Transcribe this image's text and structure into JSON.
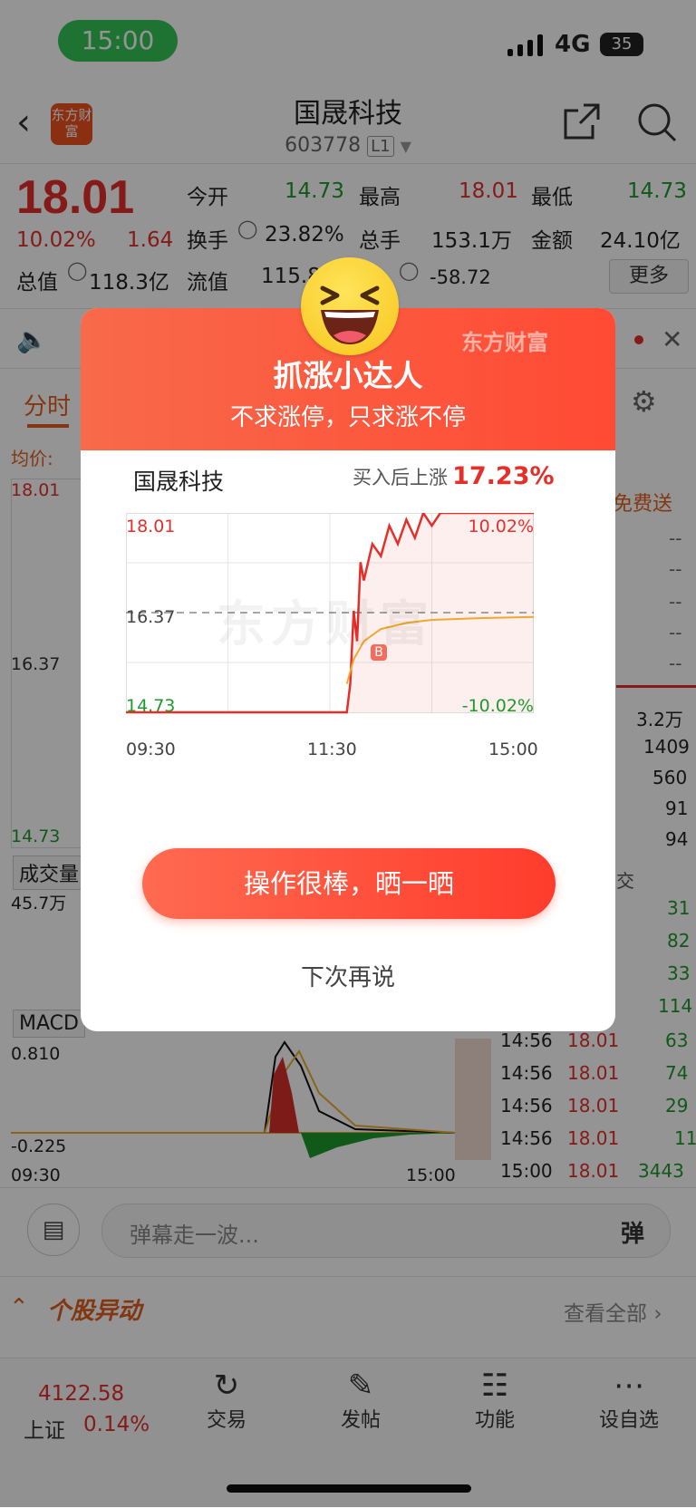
{
  "status_bar": {
    "time": "15:00",
    "network": "4G",
    "battery": "35"
  },
  "header": {
    "title": "国晟科技",
    "code": "603778",
    "level": "L1",
    "logo_text": "东方财富"
  },
  "quote": {
    "price": "18.01",
    "change_pct": "10.02%",
    "change": "1.64",
    "open_label": "今开",
    "open": "14.73",
    "high_label": "最高",
    "high": "18.01",
    "low_label": "最低",
    "low": "14.73",
    "turnover_label": "换手",
    "turnover": "23.82%",
    "volume_label": "总手",
    "volume": "153.1万",
    "amount_label": "金额",
    "amount": "24.10亿",
    "mktcap_label": "总值",
    "mktcap": "118.3亿",
    "float_label": "流值",
    "float": "115.8",
    "pe_label": "盈",
    "pe_sup": "动",
    "pe": "-58.72",
    "more": "更多"
  },
  "tabs": {
    "active": "分时",
    "avg_label": "均价:"
  },
  "chart_bg": {
    "p_high": "18.01",
    "p_mid": "16.37",
    "p_low": "14.73",
    "volume_tab": "成交量",
    "volume_val": "45.7万",
    "macd_tab": "MACD",
    "macd_high": "0.810",
    "macd_low": "-0.225",
    "t_start": "09:30",
    "t_end": "15:00"
  },
  "right_panel": {
    "promo": "免费送",
    "dashes": [
      "--",
      "--",
      "--",
      "--",
      "--"
    ],
    "vols": [
      "3.2万",
      "1409",
      "560",
      "91",
      "94"
    ],
    "trades_header": "交",
    "trade_vols_top": [
      "31",
      "82",
      "33",
      "114"
    ],
    "trades": [
      {
        "time": "14:56",
        "price": "18.01",
        "vol": "63"
      },
      {
        "time": "14:56",
        "price": "18.01",
        "vol": "74"
      },
      {
        "time": "14:56",
        "price": "18.01",
        "vol": "29"
      },
      {
        "time": "14:56",
        "price": "18.01",
        "vol": "11"
      },
      {
        "time": "15:00",
        "price": "18.01",
        "vol": "3443"
      }
    ]
  },
  "comment_bar": {
    "placeholder": "弹幕走一波...",
    "danmu": "弹"
  },
  "movement": {
    "title": "个股异动",
    "view_all": "查看全部"
  },
  "bottom_nav": {
    "index_value": "4122.58",
    "index_name": "上证",
    "index_change": "0.14%",
    "items": [
      "交易",
      "发帖",
      "功能",
      "设自选"
    ]
  },
  "modal": {
    "title": "抓涨小达人",
    "subtitle": "不求涨停，只求涨不停",
    "brand": "东方财富",
    "stock_name": "国晟科技",
    "gain_label": "买入后上涨",
    "gain_value": "17.23%",
    "cta": "操作很棒，晒一晒",
    "later": "下次再说",
    "chart_watermark": "东方财富",
    "buy_marker": "B"
  },
  "chart_data": {
    "type": "line",
    "y_labels": {
      "top": "18.01",
      "mid": "16.37",
      "bottom": "14.73"
    },
    "right_labels": {
      "top": "10.02%",
      "bottom": "-10.02%"
    },
    "x_labels": [
      "09:30",
      "11:30",
      "15:00"
    ],
    "ylim": [
      14.73,
      18.01
    ],
    "series": [
      {
        "color": "#e3302b",
        "x": [
          "09:30",
          "13:10",
          "13:12",
          "13:14",
          "13:16",
          "13:18",
          "13:20",
          "13:25",
          "13:30",
          "13:35",
          "13:40",
          "13:45",
          "13:50",
          "13:55",
          "14:00",
          "14:05",
          "14:10",
          "15:00"
        ],
        "values": [
          14.73,
          14.73,
          15.2,
          16.4,
          15.9,
          17.2,
          16.9,
          17.5,
          17.3,
          17.8,
          17.5,
          17.9,
          17.6,
          18.01,
          17.8,
          18.01,
          18.01,
          18.01
        ]
      },
      {
        "color": "#f0a830",
        "x": [
          "13:10",
          "13:14",
          "13:20",
          "13:30",
          "13:45",
          "14:00",
          "14:30",
          "15:00"
        ],
        "values": [
          15.2,
          15.6,
          15.9,
          16.1,
          16.2,
          16.25,
          16.28,
          16.3
        ]
      }
    ]
  }
}
